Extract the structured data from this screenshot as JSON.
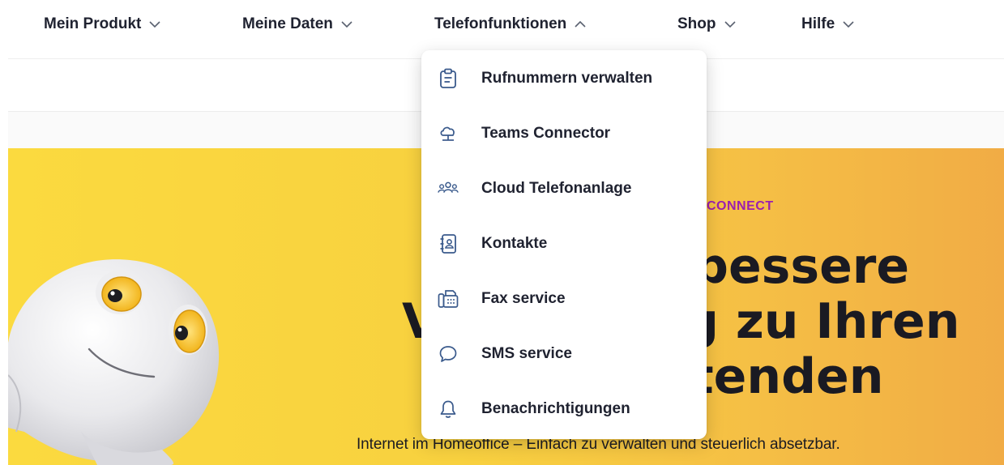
{
  "nav": {
    "items": [
      {
        "label": "Mein Produkt",
        "expanded": false
      },
      {
        "label": "Meine Daten",
        "expanded": false
      },
      {
        "label": "Telefonfunktionen",
        "expanded": true
      },
      {
        "label": "Shop",
        "expanded": false
      },
      {
        "label": "Hilfe",
        "expanded": false
      }
    ]
  },
  "dropdown": {
    "items": [
      {
        "label": "Rufnummern verwalten",
        "icon": "clipboard-icon"
      },
      {
        "label": "Teams Connector",
        "icon": "cloud-connector-icon"
      },
      {
        "label": "Cloud Telefonanlage",
        "icon": "people-group-icon"
      },
      {
        "label": "Kontakte",
        "icon": "contact-book-icon"
      },
      {
        "label": "Fax service",
        "icon": "fax-icon"
      },
      {
        "label": "SMS service",
        "icon": "chat-bubble-icon"
      },
      {
        "label": "Benachrichtigungen",
        "icon": "bell-icon"
      }
    ]
  },
  "hero": {
    "eyebrow": "CONNECT",
    "headline_line1": "bessere",
    "headline_line2": "Verbindung zu Ihren",
    "headline_line3": "tenden",
    "subline": "Internet im Homeoffice – Einfach zu verwalten und steuerlich absetzbar."
  },
  "colors": {
    "hero_start": "#fbda3f",
    "hero_end": "#f1ac45",
    "eyebrow": "#9b1fb0",
    "icon_blue": "#3a5a8c",
    "text_dark": "#1f2230"
  }
}
